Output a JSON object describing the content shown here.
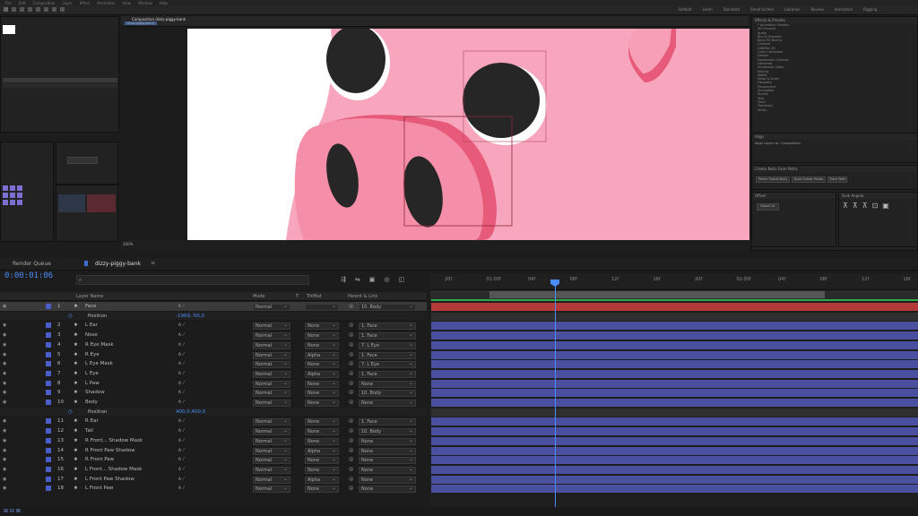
{
  "menu": [
    "File",
    "Edit",
    "Composition",
    "Layer",
    "Effect",
    "Animation",
    "View",
    "Window",
    "Help"
  ],
  "workspaces": [
    "Default",
    "Learn",
    "Standard",
    "Small Screen",
    "Libraries",
    "Review",
    "Animation",
    "Rigging"
  ],
  "composition_tab": "Composition dizzy-piggy-bank",
  "comp_subtab": "dizzy-piggy-bank",
  "viewer_zoom": "100%",
  "timeline": {
    "render_queue_tab": "Render Queue",
    "comp_tab": "dizzy-piggy-bank",
    "timecode": "0:00:01:06",
    "search_icon": "search-icon",
    "columns": {
      "layer_name": "Layer Name",
      "mode": "Mode",
      "t": "T",
      "trkmat": "TrkMat",
      "parent": "Parent & Link"
    },
    "ruler_ticks": [
      "20f",
      "01:00f",
      "04f",
      "08f",
      "12f",
      "16f",
      "20f",
      "02:00f",
      "04f",
      "08f",
      "12f",
      "16f"
    ],
    "layers": [
      {
        "num": "1",
        "name": "Face",
        "mode": "Normal",
        "trk": "",
        "parent": "10. Body",
        "sel": true
      },
      {
        "prop": true,
        "name": "Position",
        "value": "-1969,-50,0"
      },
      {
        "num": "2",
        "name": "L Ear",
        "mode": "Normal",
        "trk": "None",
        "parent": "1. Face"
      },
      {
        "num": "3",
        "name": "Nose",
        "mode": "Normal",
        "trk": "None",
        "parent": "1. Face"
      },
      {
        "num": "4",
        "name": "R Eye Mask",
        "mode": "Normal",
        "trk": "None",
        "parent": "7. L Eye"
      },
      {
        "num": "5",
        "name": "R Eye",
        "mode": "Normal",
        "trk": "Alpha",
        "parent": "1. Face"
      },
      {
        "num": "6",
        "name": "L Eye Mask",
        "mode": "Normal",
        "trk": "None",
        "parent": "7. L Eye"
      },
      {
        "num": "7",
        "name": "L Eye",
        "mode": "Normal",
        "trk": "Alpha",
        "parent": "1. Face"
      },
      {
        "num": "8",
        "name": "L Paw",
        "mode": "Normal",
        "trk": "None",
        "parent": "None"
      },
      {
        "num": "9",
        "name": "Shadow",
        "mode": "Normal",
        "trk": "None",
        "parent": "10. Body"
      },
      {
        "num": "10",
        "name": "Body",
        "mode": "Normal",
        "trk": "None",
        "parent": "None"
      },
      {
        "prop": true,
        "name": "Position",
        "value": "400,0,400,0"
      },
      {
        "num": "11",
        "name": "R Ear",
        "mode": "Normal",
        "trk": "None",
        "parent": "1. Face"
      },
      {
        "num": "12",
        "name": "Tail",
        "mode": "Normal",
        "trk": "None",
        "parent": "10. Body"
      },
      {
        "num": "13",
        "name": "R Front... Shadow Mask",
        "mode": "Normal",
        "trk": "None",
        "parent": "None"
      },
      {
        "num": "14",
        "name": "R Front Paw Shadow",
        "mode": "Normal",
        "trk": "Alpha",
        "parent": "None"
      },
      {
        "num": "15",
        "name": "R Front Paw",
        "mode": "Normal",
        "trk": "None",
        "parent": "None"
      },
      {
        "num": "16",
        "name": "L Front... Shadow Mask",
        "mode": "Normal",
        "trk": "None",
        "parent": "None"
      },
      {
        "num": "17",
        "name": "L Front Paw Shadow",
        "mode": "Normal",
        "trk": "Alpha",
        "parent": "None"
      },
      {
        "num": "18",
        "name": "L Front Paw",
        "mode": "Normal",
        "trk": "None",
        "parent": "None"
      }
    ]
  },
  "effects_panel": {
    "title": "Effects & Presets",
    "items": [
      "* Animation Presets",
      "3D Channel",
      "Audio",
      "Blur & Sharpen",
      "Boris FX Mocha",
      "Channel",
      "CINEMA 4D",
      "Color Correction",
      "Distort",
      "Expression Controls",
      "Generate",
      "Immersive Video",
      "Keying",
      "Matte",
      "Noise & Grain",
      "Obsolete",
      "Perspective",
      "Simulation",
      "Stylize",
      "Text",
      "Time",
      "Transition",
      "Utility"
    ]
  },
  "align_panel": {
    "title": "Align",
    "label": "Align Layers to:",
    "value": "Composition"
  },
  "create_nulls": {
    "title": "Create Nulls From Paths",
    "buttons": [
      "Points Follow Nulls",
      "Nulls Follow Points",
      "Trace Path"
    ]
  },
  "offset_panel": {
    "title": "Offset",
    "btn": "Reset Ctr"
  },
  "duik_title": "Duik Angela",
  "colors": {
    "pig_pink": "#f8a6bd",
    "pig_dark_pink": "#e85a79",
    "eye": "#262626",
    "accent": "#4b8df8",
    "layer_blue": "#4b4fa0",
    "red_bar": "#b43a3a"
  }
}
